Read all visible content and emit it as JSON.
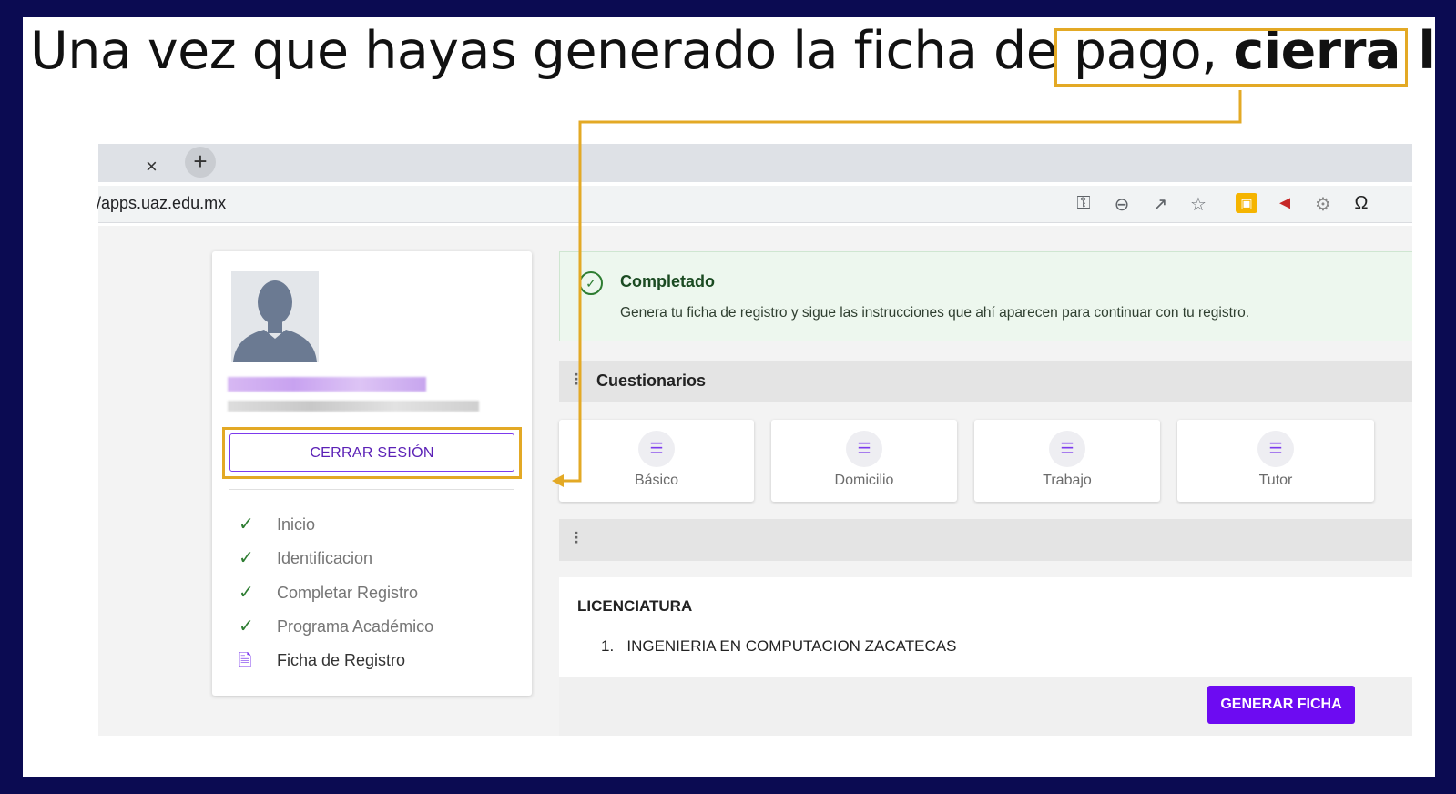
{
  "headline": {
    "text_plain": "Una vez que hayas generado la ficha de pago, ",
    "text_bold": "cierra la sesión",
    "text_end": "."
  },
  "browser": {
    "tab_close": "×",
    "new_tab": "+",
    "url": "/apps.uaz.edu.mx",
    "toolbar_icons": [
      "key-icon",
      "zoom-out-icon",
      "share-icon",
      "star-icon",
      "extension-icon",
      "megaphone-icon",
      "gear-extension-icon",
      "omega-icon"
    ]
  },
  "profile": {
    "logout_label": "CERRAR SESIÓN",
    "steps": [
      {
        "label": "Inicio",
        "icon": "check-icon",
        "done": true
      },
      {
        "label": "Identificacion",
        "icon": "check-icon",
        "done": true
      },
      {
        "label": "Completar Registro",
        "icon": "check-icon",
        "done": true
      },
      {
        "label": "Programa Académico",
        "icon": "check-icon",
        "done": true
      },
      {
        "label": "Ficha de Registro",
        "icon": "document-icon",
        "done": false
      }
    ]
  },
  "alert": {
    "title": "Completado",
    "message": "Genera tu ficha de registro y sigue las instrucciones que ahí aparecen para continuar con tu registro."
  },
  "cuestionarios": {
    "title": "Cuestionarios",
    "items": [
      "Básico",
      "Domicilio",
      "Trabajo",
      "Tutor"
    ]
  },
  "second_section": {
    "title": ""
  },
  "licenciatura": {
    "title": "LICENCIATURA",
    "items": [
      "1.   INGENIERIA EN COMPUTACION ZACATECAS"
    ]
  },
  "actions": {
    "generate_label": "GENERAR FICHA"
  },
  "colors": {
    "annotation": "#e3a925",
    "primary": "#6d0bf2",
    "success": "#2e7d32",
    "background": "#0b0b52"
  }
}
